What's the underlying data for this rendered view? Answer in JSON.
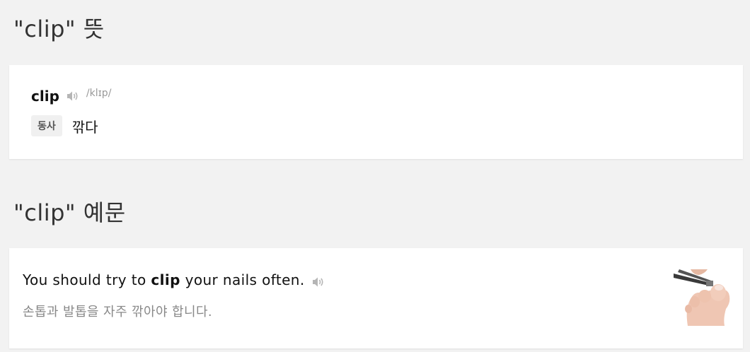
{
  "meaning_section": {
    "title": "\"clip\" 뜻"
  },
  "entry": {
    "word": "clip",
    "phonetic": "/klɪp/",
    "speaker_icon": "speaker-icon",
    "pos": "동사",
    "definition": "깎다"
  },
  "examples_section": {
    "title": "\"clip\" 예문"
  },
  "example": {
    "en_before": "You should try to ",
    "en_keyword": "clip",
    "en_after": " your nails often.",
    "ko": "손톱과 발톱을 자주 깎아야 합니다.",
    "speaker_icon": "speaker-icon",
    "image_icon": "nail-clipper-image"
  },
  "colors": {
    "background": "#f2f2f2",
    "card": "#ffffff",
    "muted_text": "#888888",
    "badge_bg": "#f0f0f0"
  }
}
